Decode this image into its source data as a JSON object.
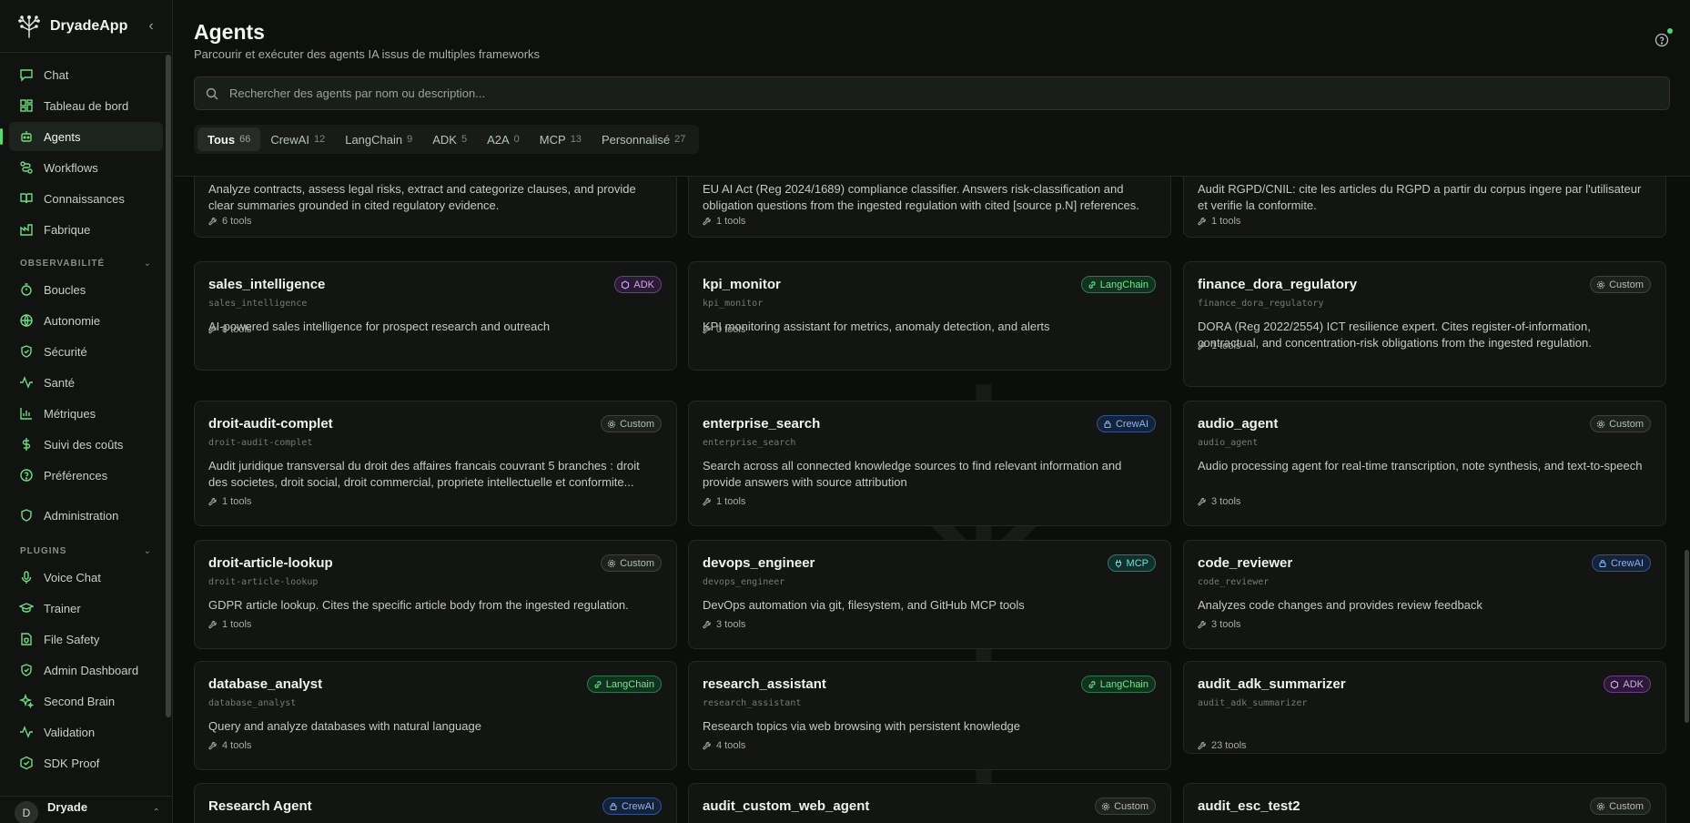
{
  "app": {
    "name": "DryadeApp",
    "collapse_icon": "chevron-left-icon"
  },
  "nav": {
    "main": [
      {
        "label": "Chat",
        "icon": "message-square-icon"
      },
      {
        "label": "Tableau de bord",
        "icon": "layout-dashboard-icon"
      },
      {
        "label": "Agents",
        "icon": "bot-icon",
        "active": true
      },
      {
        "label": "Workflows",
        "icon": "workflow-icon"
      },
      {
        "label": "Connaissances",
        "icon": "book-open-icon"
      },
      {
        "label": "Fabrique",
        "icon": "factory-icon"
      }
    ],
    "observability_title": "OBSERVABILITÉ",
    "observability": [
      {
        "label": "Boucles",
        "icon": "timer-icon"
      },
      {
        "label": "Autonomie",
        "icon": "globe-icon"
      },
      {
        "label": "Sécurité",
        "icon": "shield-check-icon"
      },
      {
        "label": "Santé",
        "icon": "activity-icon"
      },
      {
        "label": "Métriques",
        "icon": "bar-chart-icon"
      },
      {
        "label": "Suivi des coûts",
        "icon": "dollar-icon"
      },
      {
        "label": "Préférences",
        "icon": "help-circle-icon"
      }
    ],
    "admin": {
      "label": "Administration",
      "icon": "shield-icon"
    },
    "plugins_title": "PLUGINS",
    "plugins": [
      {
        "label": "Voice Chat",
        "icon": "mic-icon"
      },
      {
        "label": "Trainer",
        "icon": "graduation-cap-icon"
      },
      {
        "label": "File Safety",
        "icon": "file-shield-icon"
      },
      {
        "label": "Admin Dashboard",
        "icon": "shield-check-icon"
      },
      {
        "label": "Second Brain",
        "icon": "sparkles-icon"
      },
      {
        "label": "Validation",
        "icon": "activity-icon"
      },
      {
        "label": "SDK Proof",
        "icon": "package-check-icon"
      }
    ],
    "user": {
      "initial": "D",
      "name": "Dryade"
    }
  },
  "header": {
    "title": "Agents",
    "subtitle": "Parcourir et exécuter des agents IA issus de multiples frameworks",
    "search_placeholder": "Rechercher des agents par nom ou description...",
    "search_value": ""
  },
  "tabs": [
    {
      "label": "Tous",
      "count": "66",
      "active": true
    },
    {
      "label": "CrewAI",
      "count": "12"
    },
    {
      "label": "LangChain",
      "count": "9"
    },
    {
      "label": "ADK",
      "count": "5"
    },
    {
      "label": "A2A",
      "count": "0"
    },
    {
      "label": "MCP",
      "count": "13"
    },
    {
      "label": "Personnalisé",
      "count": "27"
    }
  ],
  "cards_partial": [
    {
      "desc": "Analyze contracts, assess legal risks, extract and categorize clauses, and provide clear summaries grounded in cited regulatory evidence.",
      "tools": "6 tools"
    },
    {
      "desc": "EU AI Act (Reg 2024/1689) compliance classifier. Answers risk-classification and obligation questions from the ingested regulation with cited [source p.N] references.",
      "tools": "1 tools"
    },
    {
      "desc": "Audit RGPD/CNIL: cite les articles du RGPD a partir du corpus ingere par l'utilisateur et verifie la conformite.",
      "tools": "1 tools"
    }
  ],
  "cards": [
    {
      "name": "sales_intelligence",
      "id": "sales_intelligence",
      "badge": "ADK",
      "desc": "AI-powered sales intelligence for prospect research and outreach",
      "tools": "8 tools"
    },
    {
      "name": "kpi_monitor",
      "id": "kpi_monitor",
      "badge": "LangChain",
      "desc": "KPI monitoring assistant for metrics, anomaly detection, and alerts",
      "tools": "0 tools"
    },
    {
      "name": "finance_dora_regulatory",
      "id": "finance_dora_regulatory",
      "badge": "Custom",
      "desc": "DORA (Reg 2022/2554) ICT resilience expert. Cites register-of-information, contractual, and concentration-risk obligations from the ingested regulation.",
      "tools": "1 tools"
    },
    {
      "name": "droit-audit-complet",
      "id": "droit-audit-complet",
      "badge": "Custom",
      "desc": "Audit juridique transversal du droit des affaires francais couvrant 5 branches : droit des societes, droit social, droit commercial, propriete intellectuelle et conformite...",
      "tools": "1 tools"
    },
    {
      "name": "enterprise_search",
      "id": "enterprise_search",
      "badge": "CrewAI",
      "desc": "Search across all connected knowledge sources to find relevant information and provide answers with source attribution",
      "tools": "1 tools"
    },
    {
      "name": "audio_agent",
      "id": "audio_agent",
      "badge": "Custom",
      "desc": "Audio processing agent for real-time transcription, note synthesis, and text-to-speech",
      "tools": "3 tools"
    },
    {
      "name": "droit-article-lookup",
      "id": "droit-article-lookup",
      "badge": "Custom",
      "desc": "GDPR article lookup. Cites the specific article body from the ingested regulation.",
      "tools": "1 tools"
    },
    {
      "name": "devops_engineer",
      "id": "devops_engineer",
      "badge": "MCP",
      "desc": "DevOps automation via git, filesystem, and GitHub MCP tools",
      "tools": "3 tools"
    },
    {
      "name": "code_reviewer",
      "id": "code_reviewer",
      "badge": "CrewAI",
      "desc": "Analyzes code changes and provides review feedback",
      "tools": "3 tools"
    },
    {
      "name": "database_analyst",
      "id": "database_analyst",
      "badge": "LangChain",
      "desc": "Query and analyze databases with natural language",
      "tools": "4 tools"
    },
    {
      "name": "research_assistant",
      "id": "research_assistant",
      "badge": "LangChain",
      "desc": "Research topics via web browsing with persistent knowledge",
      "tools": "4 tools"
    },
    {
      "name": "audit_adk_summarizer",
      "id": "audit_adk_summarizer",
      "badge": "ADK",
      "desc": "",
      "tools": "23 tools"
    },
    {
      "name": "Research Agent",
      "id": "",
      "badge": "CrewAI",
      "desc": "",
      "tools": ""
    },
    {
      "name": "audit_custom_web_agent",
      "id": "",
      "badge": "Custom",
      "desc": "",
      "tools": ""
    },
    {
      "name": "audit_esc_test2",
      "id": "",
      "badge": "Custom",
      "desc": "",
      "tools": ""
    }
  ],
  "colors": {
    "accent": "#5ad874",
    "background": "#0c0e0c"
  }
}
